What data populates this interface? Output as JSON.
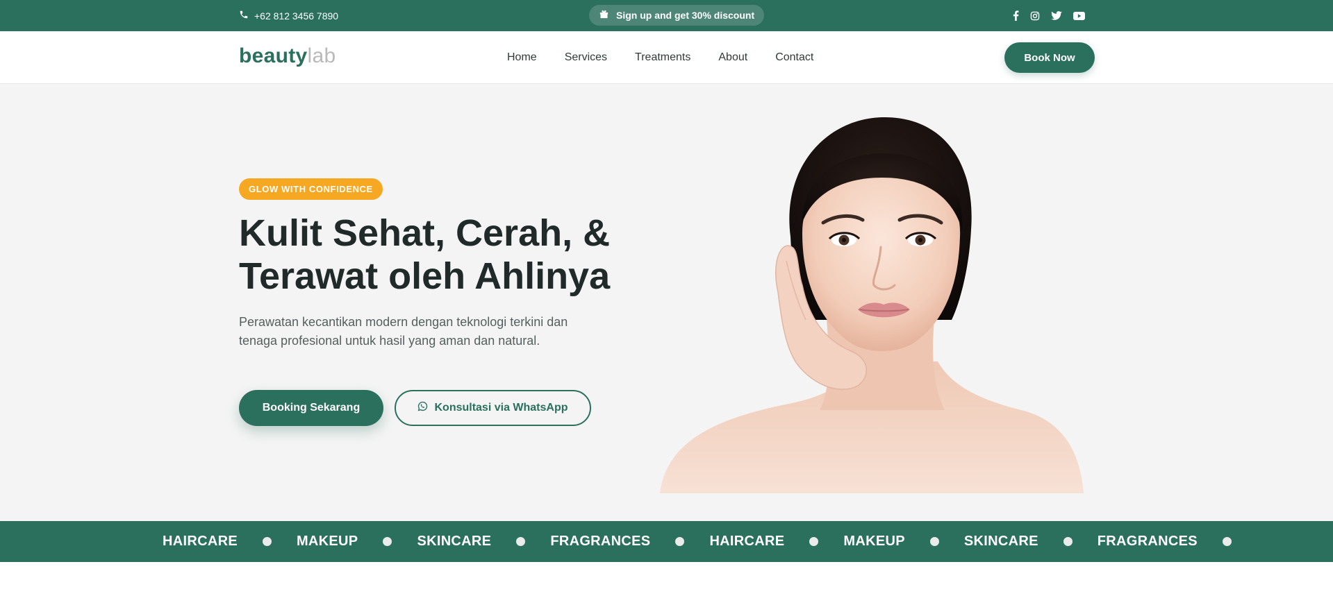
{
  "topbar": {
    "phone": "+62 812 3456 7890",
    "promo": "Sign up and get 30% discount",
    "socials": [
      "facebook-icon",
      "instagram-icon",
      "twitter-icon",
      "youtube-icon"
    ]
  },
  "header": {
    "logo_bold": "beauty",
    "logo_light": "lab",
    "nav": [
      "Home",
      "Services",
      "Treatments",
      "About",
      "Contact"
    ],
    "book_now": "Book Now"
  },
  "hero": {
    "badge": "GLOW WITH CONFIDENCE",
    "headline_line1": "Kulit Sehat, Cerah, &",
    "headline_line2": "Terawat oleh Ahlinya",
    "subtext": "Perawatan kecantikan modern dengan teknologi terkini dan tenaga profesional untuk hasil yang aman dan natural.",
    "btn_primary": "Booking Sekarang",
    "btn_whatsapp": "Konsultasi via WhatsApp"
  },
  "ticker": {
    "items": [
      "HAIRCARE",
      "MAKEUP",
      "SKINCARE",
      "FRAGRANCES",
      "HAIRCARE",
      "MAKEUP",
      "SKINCARE",
      "FRAGRANCES"
    ]
  },
  "colors": {
    "brand": "#2b6f5d",
    "accent": "#f6a823",
    "hero_bg": "#f4f4f4"
  }
}
